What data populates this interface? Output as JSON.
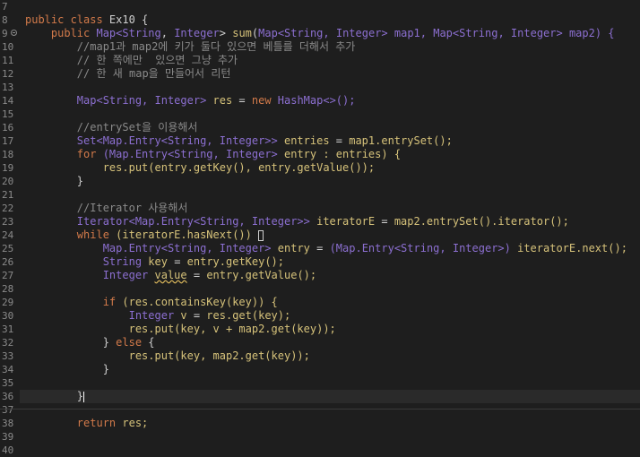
{
  "editor": {
    "lines": [
      {
        "n": "7",
        "segments": []
      },
      {
        "n": "8",
        "segments": [
          {
            "t": "public class ",
            "c": "kw"
          },
          {
            "t": "Ex10 {",
            "c": "std"
          }
        ]
      },
      {
        "n": "9",
        "fold": true,
        "segments": [
          {
            "t": "    public ",
            "c": "kw"
          },
          {
            "t": "Map<",
            "c": "type"
          },
          {
            "t": "String",
            "c": "type"
          },
          {
            "t": ", ",
            "c": "std"
          },
          {
            "t": "Integer",
            "c": "type"
          },
          {
            "t": "> ",
            "c": "std"
          },
          {
            "t": "sum",
            "c": "met"
          },
          {
            "t": "(",
            "c": "std"
          },
          {
            "t": "Map<String, Integer> map1, Map<String, Integer> map2) {",
            "c": "type"
          }
        ]
      },
      {
        "n": "10",
        "segments": [
          {
            "t": "        //map1과 map2에 키가 둘다 있으면 베틀를 더해서 추가",
            "c": "cmt"
          }
        ]
      },
      {
        "n": "11",
        "segments": [
          {
            "t": "        // 한 쪽에만  있으면 그냥 추가",
            "c": "cmt"
          }
        ]
      },
      {
        "n": "12",
        "segments": [
          {
            "t": "        // 한 새 map을 만들어서 리턴",
            "c": "cmt"
          }
        ]
      },
      {
        "n": "13",
        "segments": []
      },
      {
        "n": "14",
        "segments": [
          {
            "t": "        Map<String, Integer> ",
            "c": "type"
          },
          {
            "t": "res ",
            "c": "var"
          },
          {
            "t": "= ",
            "c": "std"
          },
          {
            "t": "new ",
            "c": "kw"
          },
          {
            "t": "HashMap<>();",
            "c": "type"
          }
        ]
      },
      {
        "n": "15",
        "segments": []
      },
      {
        "n": "16",
        "segments": [
          {
            "t": "        //entrySet을 이용해서",
            "c": "cmt"
          }
        ]
      },
      {
        "n": "17",
        "segments": [
          {
            "t": "        Set<Map.Entry<String, Integer>> ",
            "c": "type"
          },
          {
            "t": "entries ",
            "c": "var"
          },
          {
            "t": "= ",
            "c": "std"
          },
          {
            "t": "map1.entrySet();",
            "c": "var"
          }
        ]
      },
      {
        "n": "18",
        "segments": [
          {
            "t": "        for ",
            "c": "kw"
          },
          {
            "t": "(Map.Entry<String, Integer> ",
            "c": "type"
          },
          {
            "t": "entry ",
            "c": "var"
          },
          {
            "t": ": entries) {",
            "c": "var"
          }
        ]
      },
      {
        "n": "19",
        "segments": [
          {
            "t": "            res.put(entry.getKey(), entry.getValue());",
            "c": "var"
          }
        ]
      },
      {
        "n": "20",
        "segments": [
          {
            "t": "        }",
            "c": "std"
          }
        ]
      },
      {
        "n": "21",
        "segments": []
      },
      {
        "n": "22",
        "segments": [
          {
            "t": "        //Iterator 사용해서",
            "c": "cmt"
          }
        ]
      },
      {
        "n": "23",
        "segments": [
          {
            "t": "        Iterator<Map.Entry<String, Integer>> ",
            "c": "type"
          },
          {
            "t": "iteratorE ",
            "c": "var"
          },
          {
            "t": "= ",
            "c": "std"
          },
          {
            "t": "map2.entrySet().iterator();",
            "c": "var"
          }
        ]
      },
      {
        "n": "24",
        "marker": true,
        "segments": [
          {
            "t": "        while ",
            "c": "kw"
          },
          {
            "t": "(iteratorE.hasNext()) ",
            "c": "var"
          }
        ]
      },
      {
        "n": "25",
        "segments": [
          {
            "t": "            Map.Entry<String, Integer> ",
            "c": "type"
          },
          {
            "t": "entry ",
            "c": "var"
          },
          {
            "t": "= ",
            "c": "std"
          },
          {
            "t": "(Map.Entry<String, Integer>) ",
            "c": "type"
          },
          {
            "t": "iteratorE.next();",
            "c": "var"
          }
        ]
      },
      {
        "n": "26",
        "segments": [
          {
            "t": "            String ",
            "c": "type"
          },
          {
            "t": "key ",
            "c": "var"
          },
          {
            "t": "= ",
            "c": "std"
          },
          {
            "t": "entry.getKey();",
            "c": "var"
          }
        ]
      },
      {
        "n": "27",
        "segments": [
          {
            "t": "            Integer ",
            "c": "type"
          },
          {
            "t": "value",
            "c": "var",
            "warn": true
          },
          {
            "t": " = ",
            "c": "std"
          },
          {
            "t": "entry.getValue();",
            "c": "var"
          }
        ]
      },
      {
        "n": "28",
        "segments": []
      },
      {
        "n": "29",
        "segments": [
          {
            "t": "            if ",
            "c": "kw"
          },
          {
            "t": "(res.containsKey(key)) {",
            "c": "var"
          }
        ]
      },
      {
        "n": "30",
        "segments": [
          {
            "t": "                Integer ",
            "c": "type"
          },
          {
            "t": "v ",
            "c": "var"
          },
          {
            "t": "= ",
            "c": "std"
          },
          {
            "t": "res.get(key);",
            "c": "var"
          }
        ]
      },
      {
        "n": "31",
        "segments": [
          {
            "t": "                res.put(key, v + map2.get(key));",
            "c": "var"
          }
        ]
      },
      {
        "n": "32",
        "segments": [
          {
            "t": "            } ",
            "c": "std"
          },
          {
            "t": "else ",
            "c": "kw"
          },
          {
            "t": "{",
            "c": "std"
          }
        ]
      },
      {
        "n": "33",
        "segments": [
          {
            "t": "                res.put(key, map2.get(key));",
            "c": "var"
          }
        ]
      },
      {
        "n": "34",
        "segments": [
          {
            "t": "            }",
            "c": "std"
          }
        ]
      },
      {
        "n": "35",
        "segments": []
      },
      {
        "n": "36",
        "current": true,
        "caret": true,
        "segments": [
          {
            "t": "        }",
            "c": "std"
          }
        ]
      },
      {
        "n": "37",
        "segments": []
      },
      {
        "n": "38",
        "segments": [
          {
            "t": "        return ",
            "c": "kw"
          },
          {
            "t": "res;",
            "c": "var"
          }
        ]
      },
      {
        "n": "39",
        "segments": []
      },
      {
        "n": "40",
        "segments": []
      }
    ]
  }
}
